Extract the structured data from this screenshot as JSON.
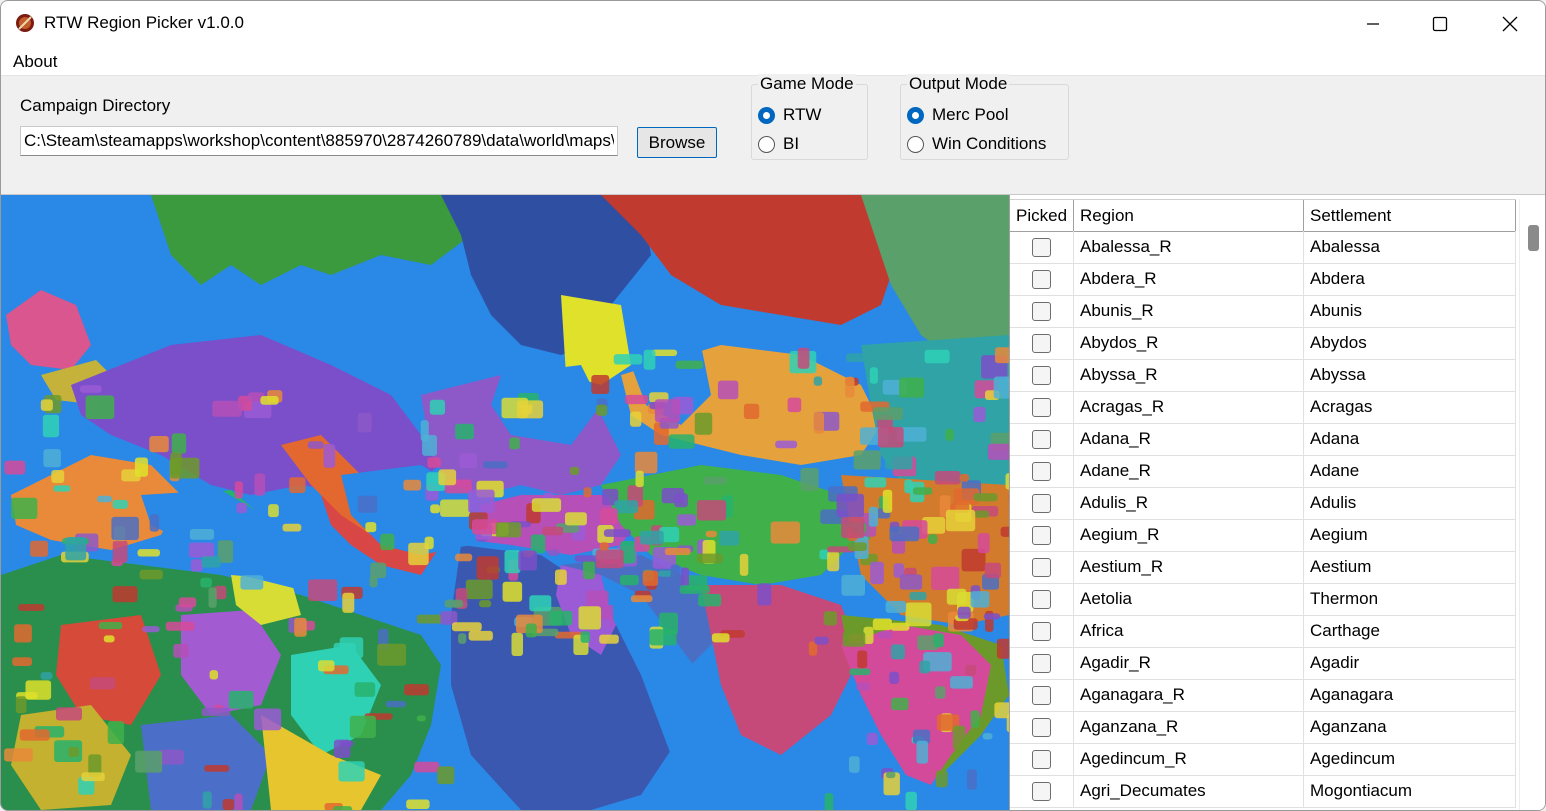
{
  "window": {
    "title": "RTW Region Picker v1.0.0"
  },
  "menu": {
    "about": "About"
  },
  "campaign": {
    "label": "Campaign Directory",
    "path": "C:\\Steam\\steamapps\\workshop\\content\\885970\\2874260789\\data\\world\\maps\\campaign\\imperial_campaign",
    "browse": "Browse"
  },
  "game_mode": {
    "legend": "Game Mode",
    "options": [
      {
        "label": "RTW",
        "selected": true
      },
      {
        "label": "BI",
        "selected": false
      }
    ]
  },
  "output_mode": {
    "legend": "Output Mode",
    "options": [
      {
        "label": "Merc Pool",
        "selected": true
      },
      {
        "label": "Win Conditions",
        "selected": false
      }
    ]
  },
  "colors": {
    "accent": "#0067c0",
    "sea": "#2a88e6"
  },
  "grid": {
    "columns": [
      "Picked",
      "Region",
      "Settlement"
    ],
    "rows": [
      {
        "region": "Abalessa_R",
        "settlement": "Abalessa",
        "picked": false
      },
      {
        "region": "Abdera_R",
        "settlement": "Abdera",
        "picked": false
      },
      {
        "region": "Abunis_R",
        "settlement": "Abunis",
        "picked": false
      },
      {
        "region": "Abydos_R",
        "settlement": "Abydos",
        "picked": false
      },
      {
        "region": "Abyssa_R",
        "settlement": "Abyssa",
        "picked": false
      },
      {
        "region": "Acragas_R",
        "settlement": "Acragas",
        "picked": false
      },
      {
        "region": "Adana_R",
        "settlement": "Adana",
        "picked": false
      },
      {
        "region": "Adane_R",
        "settlement": "Adane",
        "picked": false
      },
      {
        "region": "Adulis_R",
        "settlement": "Adulis",
        "picked": false
      },
      {
        "region": "Aegium_R",
        "settlement": "Aegium",
        "picked": false
      },
      {
        "region": "Aestium_R",
        "settlement": "Aestium",
        "picked": false
      },
      {
        "region": "Aetolia",
        "settlement": "Thermon",
        "picked": false
      },
      {
        "region": "Africa",
        "settlement": "Carthage",
        "picked": false
      },
      {
        "region": "Agadir_R",
        "settlement": "Agadir",
        "picked": false
      },
      {
        "region": "Aganagara_R",
        "settlement": "Aganagara",
        "picked": false
      },
      {
        "region": "Aganzana_R",
        "settlement": "Aganzana",
        "picked": false
      },
      {
        "region": "Agedincum_R",
        "settlement": "Agedincum",
        "picked": false
      },
      {
        "region": "Agri_Decumates",
        "settlement": "Mogontiacum",
        "picked": false
      }
    ]
  }
}
